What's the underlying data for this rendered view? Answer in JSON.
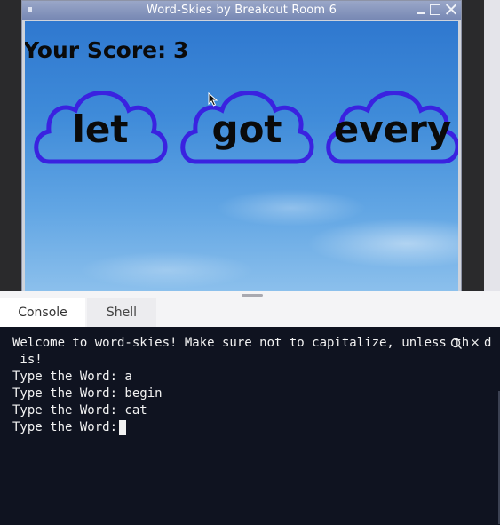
{
  "window": {
    "title": "Word-Skies by Breakout Room 6"
  },
  "game": {
    "score_label": "Your Score:",
    "score_value": "3",
    "clouds": [
      {
        "word": "let"
      },
      {
        "word": "got"
      },
      {
        "word": "every"
      }
    ]
  },
  "tabs": {
    "console": "Console",
    "shell": "Shell",
    "active": "Console"
  },
  "console": {
    "lines": [
      "Welcome to word-skies! Make sure not to capitalize, unless th",
      " is!",
      "Type the Word: a",
      "Type the Word: begin",
      "Type the Word: cat",
      "Type the Word: "
    ],
    "trailing_char": "d",
    "close_glyph": "×"
  },
  "colors": {
    "cloud_outline": "#3a22e0",
    "sky_top": "#2f78cf",
    "console_bg": "#0f1320"
  },
  "icons": {
    "window_menu": "window-menu-icon",
    "minimize": "minimize-icon",
    "maximize": "maximize-icon",
    "close": "close-icon",
    "search": "search-icon",
    "mouse_pointer": "mouse-pointer-icon"
  }
}
